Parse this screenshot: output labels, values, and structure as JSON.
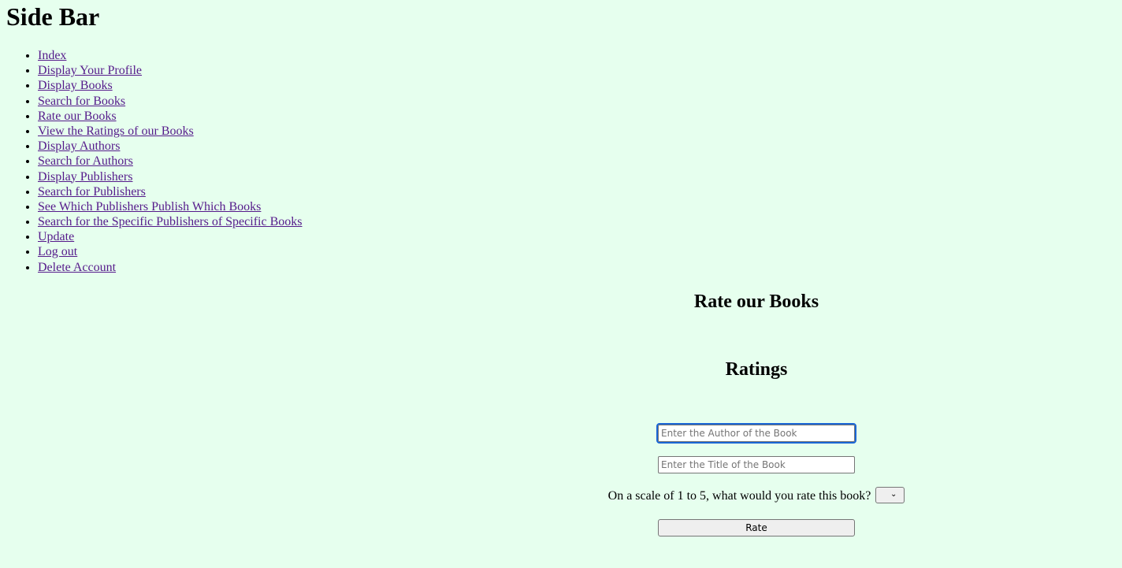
{
  "sidebar": {
    "title": "Side Bar",
    "items": [
      {
        "label": "Index"
      },
      {
        "label": "Display Your Profile"
      },
      {
        "label": "Display Books"
      },
      {
        "label": "Search for Books"
      },
      {
        "label": "Rate our Books"
      },
      {
        "label": "View the Ratings of our Books"
      },
      {
        "label": "Display Authors"
      },
      {
        "label": "Search for Authors"
      },
      {
        "label": "Display Publishers"
      },
      {
        "label": "Search for Publishers"
      },
      {
        "label": "See Which Publishers Publish Which Books"
      },
      {
        "label": "Search for the Specific Publishers of Specific Books"
      },
      {
        "label": "Update"
      },
      {
        "label": "Log out"
      },
      {
        "label": "Delete Account"
      }
    ]
  },
  "main": {
    "heading": "Rate our Books",
    "subheading": "Ratings",
    "author_input": {
      "value": "",
      "placeholder": "Enter the Author of the Book"
    },
    "title_input": {
      "value": "",
      "placeholder": "Enter the Title of the Book"
    },
    "scale_question": "On a scale of 1 to 5, what would you rate this book?",
    "rating_select": {
      "selected": "",
      "icon": "chevron-down-icon"
    },
    "rate_button": "Rate"
  },
  "colors": {
    "background": "#e6ffee",
    "link": "#551a8b",
    "focus": "#1a66d6"
  }
}
